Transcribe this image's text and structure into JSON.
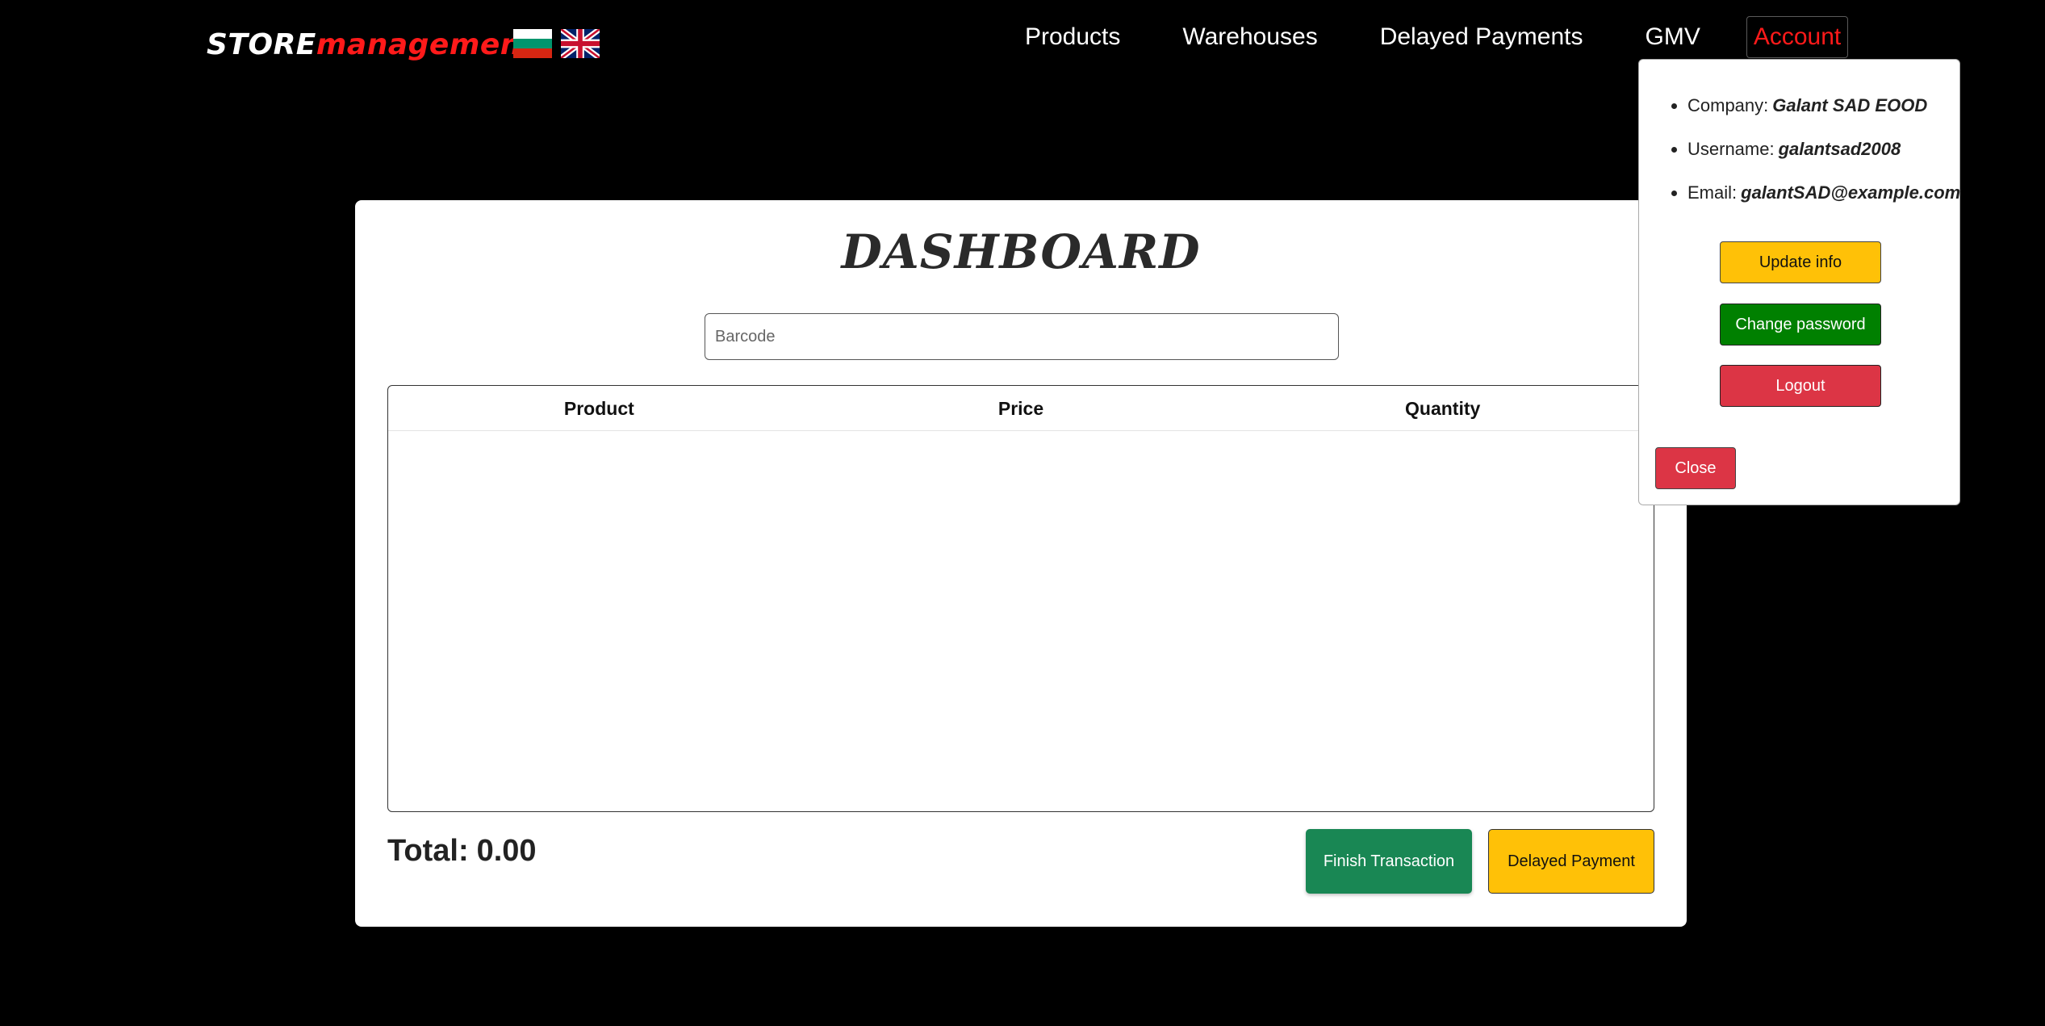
{
  "brand": {
    "part1": "STORE",
    "part2": "management"
  },
  "languages": [
    {
      "code": "bg",
      "icon": "bulgaria-flag-icon"
    },
    {
      "code": "en",
      "icon": "uk-flag-icon"
    }
  ],
  "nav": {
    "products": "Products",
    "warehouses": "Warehouses",
    "delayed_payments": "Delayed Payments",
    "gmv": "GMV",
    "account": "Account"
  },
  "colors": {
    "background": "#000000",
    "brand_accent": "#ff1a1a",
    "finish_button": "#198754",
    "delayed_button": "#ffc107",
    "update_button": "#ffc107",
    "password_button": "#008000",
    "logout_button": "#dc3545",
    "close_button": "#dc3545"
  },
  "dashboard": {
    "title": "DASHBOARD",
    "barcode_placeholder": "Barcode",
    "barcode_value": "",
    "table": {
      "columns": [
        "Product",
        "Price",
        "Quantity"
      ],
      "rows": []
    },
    "total_label": "Total:",
    "total_value": "0.00",
    "finish_label": "Finish Transaction",
    "delayed_label": "Delayed Payment"
  },
  "account_panel": {
    "company_label": "Company:",
    "company_value": "Galant SAD EOOD",
    "username_label": "Username:",
    "username_value": "galantsad2008",
    "email_label": "Email:",
    "email_value": "galantSAD@example.com",
    "update_label": "Update info",
    "change_password_label": "Change password",
    "logout_label": "Logout",
    "close_label": "Close"
  }
}
